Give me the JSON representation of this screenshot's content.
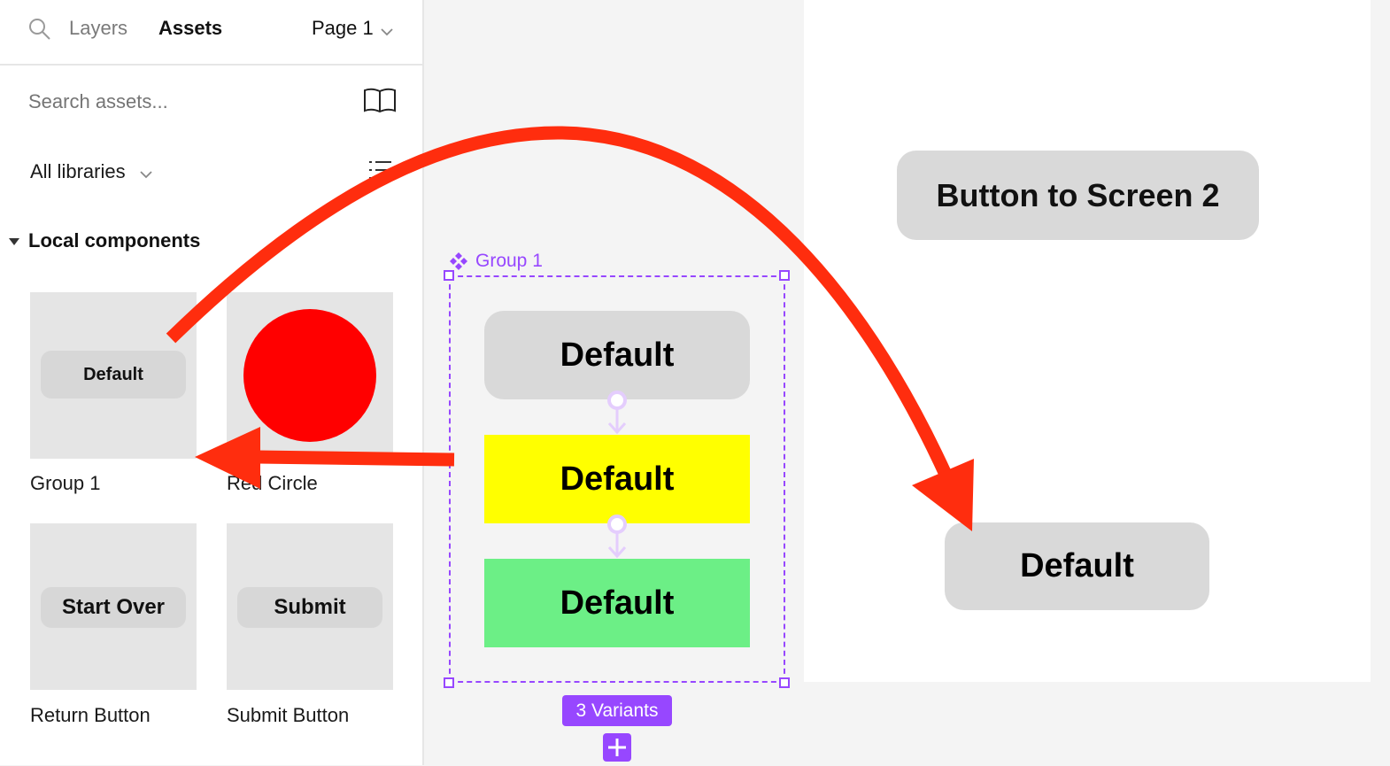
{
  "header": {
    "tabs": [
      {
        "label": "Layers"
      },
      {
        "label": "Assets"
      }
    ],
    "page_label": "Page 1"
  },
  "assets": {
    "search_placeholder": "Search assets...",
    "library_filter": "All libraries",
    "section_title": "Local components",
    "items": [
      {
        "name": "Group 1",
        "preview_label": "Default"
      },
      {
        "name": "Red Circle",
        "preview_label": ""
      },
      {
        "name": "Return Button",
        "preview_label": "Start Over"
      },
      {
        "name": "Submit Button",
        "preview_label": "Submit"
      }
    ]
  },
  "canvas": {
    "component_set_name": "Group 1",
    "variants": [
      {
        "label": "Default",
        "color": "#d9d9d9"
      },
      {
        "label": "Default",
        "color": "#ffff00"
      },
      {
        "label": "Default",
        "color": "#6cef86"
      }
    ],
    "variants_badge": "3 Variants",
    "button_screen2": "Button to Screen 2",
    "instance_label": "Default"
  },
  "colors": {
    "accent": "#9747ff",
    "annotation": "#ff2d0e",
    "red_circle": "#ff0000"
  }
}
